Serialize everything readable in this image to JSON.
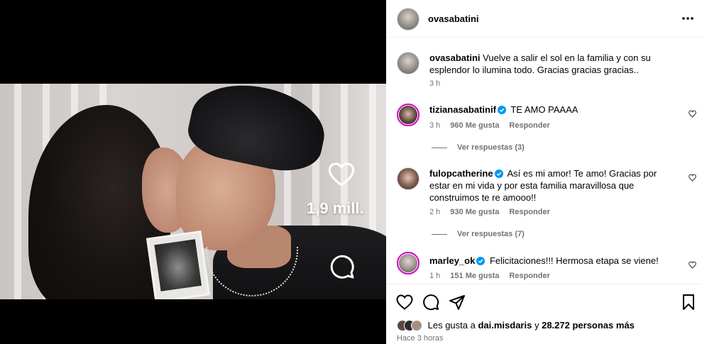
{
  "media": {
    "like_count": "1,9 mill."
  },
  "header": {
    "username": "ovasabatini"
  },
  "caption": {
    "username": "ovasabatini",
    "text": "Vuelve a salir el sol en la familia y con su esplendor lo ilumina todo. Gracias gracias gracias..",
    "time": "3 h"
  },
  "comments": [
    {
      "username": "tizianasabatinif",
      "verified": true,
      "text": "TE AMO PAAAA",
      "time": "3 h",
      "likes": "960 Me gusta",
      "reply": "Responder",
      "view_replies": "Ver respuestas (3)"
    },
    {
      "username": "fulopcatherine",
      "verified": true,
      "text": "Así es mi amor! Te amo! Gracias por estar en mi vida y por esta familia maravillosa que construimos te re amooo!!",
      "time": "2 h",
      "likes": "930 Me gusta",
      "reply": "Responder",
      "view_replies": "Ver respuestas (7)"
    },
    {
      "username": "marley_ok",
      "verified": true,
      "text": "Felicitaciones!!! Hermosa etapa se viene!",
      "time": "1 h",
      "likes": "151 Me gusta",
      "reply": "Responder"
    }
  ],
  "likes_summary": {
    "prefix": "Les gusta a",
    "user": "dai.misdaris",
    "middle": "y",
    "count": "28.272 personas más"
  },
  "post_time": "Hace 3 horas",
  "colors": {
    "verified_blue": "#0095f6",
    "story_ring": "#d300c5",
    "meta_gray": "#737373"
  },
  "icons": [
    "heart-icon",
    "comment-icon",
    "share-icon",
    "save-icon",
    "more-icon",
    "verified-icon"
  ]
}
